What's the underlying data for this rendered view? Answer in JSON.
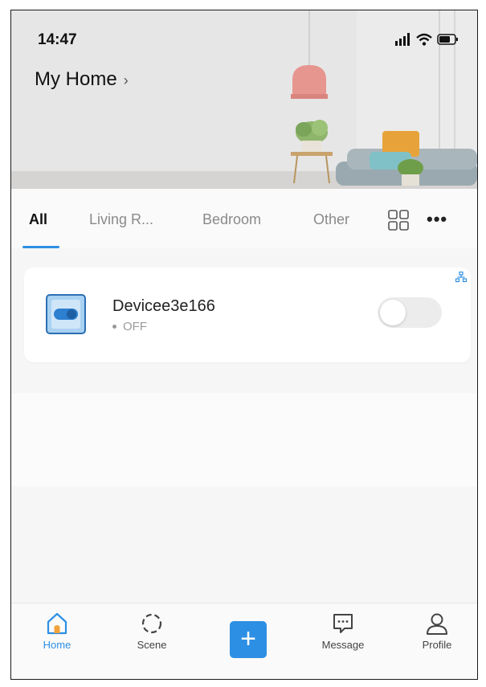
{
  "status_bar": {
    "time": "14:47"
  },
  "header": {
    "home_name": "My Home",
    "chevron": "›"
  },
  "tabs": [
    {
      "label": "All",
      "active": true
    },
    {
      "label": "Living R...",
      "active": false
    },
    {
      "label": "Bedroom",
      "active": false
    },
    {
      "label": "Other",
      "active": false
    }
  ],
  "tab_actions": {
    "grid_icon": "grid-icon",
    "more_label": "•••"
  },
  "devices": [
    {
      "name": "Devicee3e166",
      "status": "OFF",
      "icon": "switch-device-icon",
      "power_on": false
    }
  ],
  "add_button": {
    "label": "+"
  },
  "bottom_nav": [
    {
      "label": "Home",
      "icon": "home-icon",
      "active": true
    },
    {
      "label": "Scene",
      "icon": "scene-icon",
      "active": false
    },
    {
      "label": "Message",
      "icon": "message-icon",
      "active": false
    },
    {
      "label": "Profile",
      "icon": "profile-icon",
      "active": false
    }
  ],
  "colors": {
    "accent": "#2d8fe3",
    "toggle_off": "#ececec",
    "background": "#f6f6f6"
  }
}
